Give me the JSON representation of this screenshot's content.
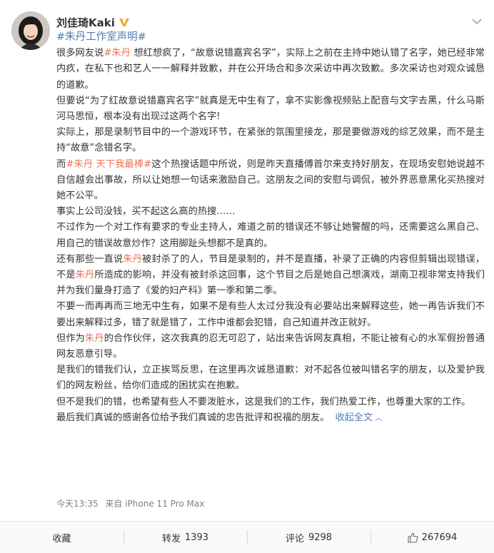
{
  "author": {
    "name": "刘佳琦Kaki",
    "verified_icon": "yellow-v-badge-icon"
  },
  "post": {
    "topic_tag": "#朱丹工作室声明#",
    "paragraphs": [
      [
        {
          "t": "很多网友说"
        },
        {
          "t": "#朱丹",
          "c": "lnk"
        },
        {
          "t": " 想红想疯了，“故意说错嘉宾名字”，实际上之前在主持中她认错了名字，她已经非常内疚，在私下也和艺人一一解释并致歉，并在公开场合和多次采访中再次致歉。多次采访也对观众诚恳的道歉。"
        }
      ],
      [
        {
          "t": "但要说“为了红故意说错嘉宾名字”就真是无中生有了，拿不实影像视频贴上配音与文字去黑，什么马斯河马思恒，根本没有出现过这两个名字!"
        }
      ],
      [
        {
          "t": "实际上，那是录制节目中的一个游戏环节，在紧张的氛围里接龙，那是要做游戏的综艺效果，而不是主持“故意”念错名字。"
        }
      ],
      [
        {
          "t": "而"
        },
        {
          "t": "#朱丹 天下我最棒#",
          "c": "lnk"
        },
        {
          "t": "这个热搜话题中所说，则是昨天直播傅首尔来支持好朋友，在现场安慰她说越不自信越会出事故，所以让她想一句话来激励自己。这朋友之间的安慰与调侃，被外界恶意黑化买热搜对她不公平。"
        }
      ],
      [
        {
          "t": "事实上公司没钱，买不起这么高的热搜……"
        }
      ],
      [
        {
          "t": "不过作为一个对工作有要求的专业主持人，难道之前的错误还不够让她警醒的吗，还需要这么黑自己、用自己的错误故意炒作？这用脚趾头想都不是真的。"
        }
      ],
      [
        {
          "t": "还有那些一直说"
        },
        {
          "t": "朱丹",
          "c": "hl"
        },
        {
          "t": "被封杀了的人，节目是录制的，并不是直播，补录了正确的内容但剪辑出现错误，不是"
        },
        {
          "t": "朱丹",
          "c": "hl"
        },
        {
          "t": "所造成的影响，并没有被封杀这回事，这个节目之后是她自己想演戏，湖南卫视非常支持我们并为我们量身打造了《爱的妇产科》第一季和第二季。"
        }
      ],
      [
        {
          "t": "不要一而再再而三地无中生有，如果不是有些人太过分我没有必要站出来解释这些，她一再告诉我们不要出来解释过多，错了就是错了，工作中谁都会犯错，自己知道并改正就好。"
        }
      ],
      [
        {
          "t": "但作为"
        },
        {
          "t": "朱丹",
          "c": "hl"
        },
        {
          "t": "的合作伙伴，这次我真的忍无可忍了，站出来告诉网友真相，不能让被有心的水军假扮普通网友恶意引导。"
        }
      ],
      [
        {
          "t": "是我们的错我们认，立正挨骂反思，在这里再次诚恳道歉：对不起各位被叫错名字的朋友，以及爱护我们的网友粉丝，给你们造成的困扰实在抱歉。"
        }
      ],
      [
        {
          "t": "但不是我们的错，也希望有些人不要泼脏水，这是我们的工作，我们热爱工作，也尊重大家的工作。"
        }
      ],
      [
        {
          "t": "最后我们真诚的感谢各位给予我们真诚的忠告批评和祝福的朋友。"
        }
      ]
    ],
    "expand_label": "收起全文",
    "expand_arrow": "︿"
  },
  "meta": {
    "time": "今天13:35",
    "source": "来自 iPhone 11 Pro Max"
  },
  "actions": {
    "favorite_label": "收藏",
    "repost_label": "转发",
    "repost_count": "1393",
    "comment_label": "评论",
    "comment_count": "9298",
    "like_count": "267694"
  },
  "colors": {
    "link": "#eb7350",
    "blue": "#507daf",
    "verified": "#f5a623"
  }
}
